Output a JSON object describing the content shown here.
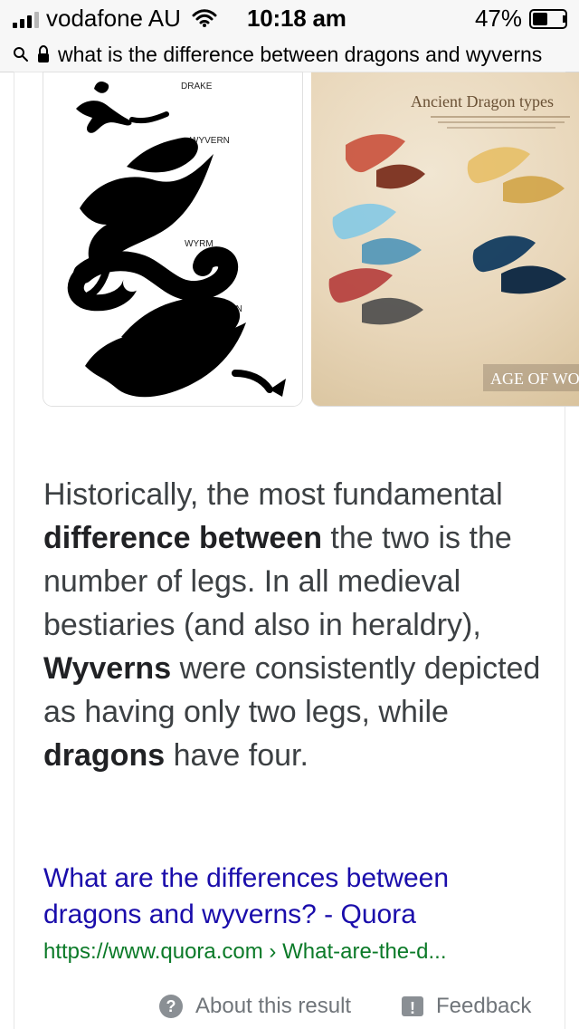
{
  "status_bar": {
    "carrier": "vodafone AU",
    "time": "10:18 am",
    "battery_percent": "47%",
    "signal_bars_active": 3,
    "signal_bars_total": 4,
    "battery_level": 0.47
  },
  "url_bar": {
    "query": "what is the difference between dragons and wyverns"
  },
  "images": {
    "left_labels": {
      "drake": "DRAKE",
      "wyvern": "WYVERN",
      "wyrm": "WYRM",
      "dragon": "DRAGON"
    },
    "right_title": "Ancient Dragon types",
    "right_watermark": "AGE OF WONDERS"
  },
  "answer": {
    "p1": "Historically, the most fundamental ",
    "b1": "difference between",
    "p2": " the two is the number of legs. In all medieval bestiaries (and also in heraldry), ",
    "b2": "Wyverns",
    "p3": " were consistently depicted as having only two legs, while ",
    "b3": "dragons",
    "p4": " have four."
  },
  "source": {
    "title": "What are the differences between dragons and wyverns? - Quora",
    "url": "https://www.quora.com › What-are-the-d..."
  },
  "footer": {
    "about_label": "About this result",
    "feedback_label": "Feedback"
  }
}
